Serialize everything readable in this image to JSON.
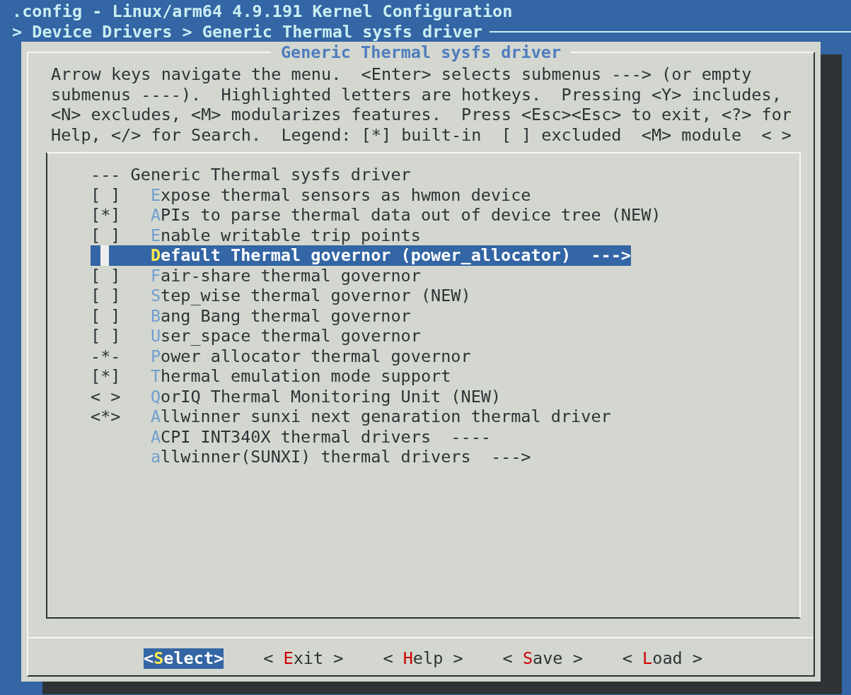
{
  "window": {
    "title": ".config - Linux/arm64 4.9.191 Kernel Configuration",
    "breadcrumb": "> Device Drivers > Generic Thermal sysfs driver"
  },
  "dialog": {
    "title": "Generic Thermal sysfs driver",
    "help_lines": [
      "Arrow keys navigate the menu.  <Enter> selects submenus ---> (or empty",
      "submenus ----).  Highlighted letters are hotkeys.  Pressing <Y> includes,",
      "<N> excludes, <M> modularizes features.  Press <Esc><Esc> to exit, <?> for",
      "Help, </> for Search.  Legend: [*] built-in  [ ] excluded  <M> module  < >"
    ]
  },
  "menu": [
    {
      "kind": "comment",
      "text": "--- Generic Thermal sysfs driver",
      "selected": false
    },
    {
      "kind": "option",
      "marker": "[ ]",
      "hotkey": "E",
      "text": "xpose thermal sensors as hwmon device",
      "selected": false
    },
    {
      "kind": "option",
      "marker": "[*]",
      "hotkey": "A",
      "text": "PIs to parse thermal data out of device tree (NEW)",
      "selected": false
    },
    {
      "kind": "option",
      "marker": "[ ]",
      "hotkey": "E",
      "text": "nable writable trip points",
      "selected": false
    },
    {
      "kind": "option",
      "hotkey": "D",
      "text": "efault Thermal governor (power_allocator)  --->",
      "selected": true
    },
    {
      "kind": "option",
      "marker": "[ ]",
      "hotkey": "F",
      "text": "air-share thermal governor",
      "selected": false
    },
    {
      "kind": "option",
      "marker": "[ ]",
      "hotkey": "S",
      "text": "tep_wise thermal governor (NEW)",
      "selected": false
    },
    {
      "kind": "option",
      "marker": "[ ]",
      "hotkey": "B",
      "text": "ang Bang thermal governor",
      "selected": false
    },
    {
      "kind": "option",
      "marker": "[ ]",
      "hotkey": "U",
      "text": "ser_space thermal governor",
      "selected": false
    },
    {
      "kind": "option",
      "marker": "-*-",
      "hotkey": "P",
      "text": "ower allocator thermal governor",
      "selected": false
    },
    {
      "kind": "option",
      "marker": "[*]",
      "hotkey": "T",
      "text": "hermal emulation mode support",
      "selected": false
    },
    {
      "kind": "option",
      "marker": "< >",
      "hotkey": "Q",
      "text": "orIQ Thermal Monitoring Unit (NEW)",
      "selected": false
    },
    {
      "kind": "option",
      "marker": "<*>",
      "hotkey": "A",
      "text": "llwinner sunxi next genaration thermal driver",
      "selected": false
    },
    {
      "kind": "option",
      "hotkey": "A",
      "text": "CPI INT340X thermal drivers  ----",
      "selected": false
    },
    {
      "kind": "option",
      "hotkey": "a",
      "text": "llwinner(SUNXI) thermal drivers  --->",
      "selected": false
    }
  ],
  "buttons": [
    {
      "prefix": "<",
      "hotkey": "S",
      "text": "elect",
      "suffix": ">",
      "selected": true
    },
    {
      "prefix": "< ",
      "hotkey": "E",
      "text": "xit",
      "suffix": " >",
      "selected": false
    },
    {
      "prefix": "< ",
      "hotkey": "H",
      "text": "elp",
      "suffix": " >",
      "selected": false
    },
    {
      "prefix": "< ",
      "hotkey": "S",
      "text": "ave",
      "suffix": " >",
      "selected": false
    },
    {
      "prefix": "< ",
      "hotkey": "L",
      "text": "oad",
      "suffix": " >",
      "selected": false
    }
  ]
}
